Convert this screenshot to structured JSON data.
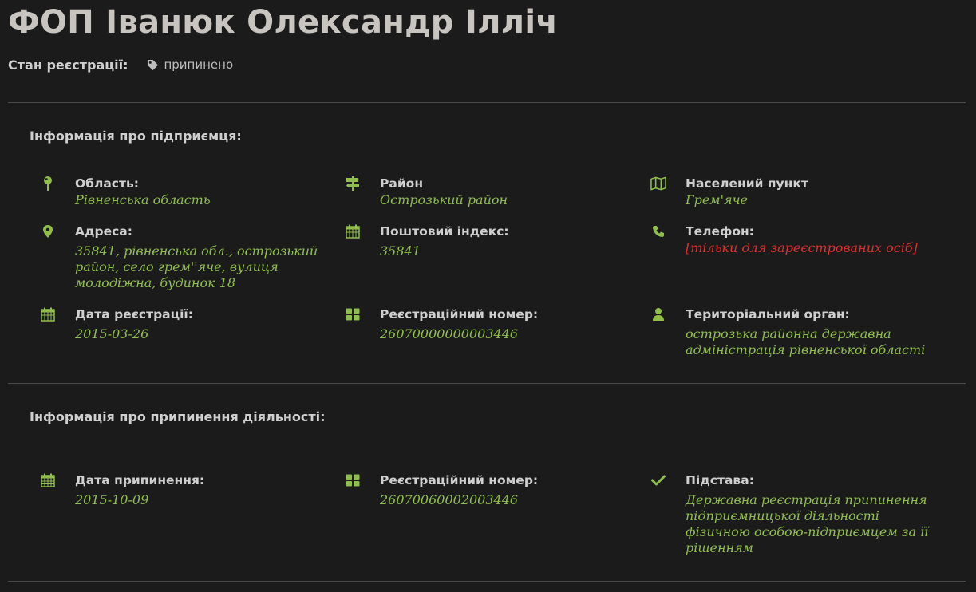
{
  "header": {
    "title": "ФОП Іванюк Олександр Ілліч",
    "status_label": "Стан реєстрації:",
    "status_value": "припинено",
    "status_icon": "tag-icon"
  },
  "colors": {
    "background": "#1b1b1c",
    "accent_green": "#8fbf4a",
    "warning_red": "#e0302b",
    "label_text": "#cfcfcf",
    "title_text": "#c8c4bf"
  },
  "enterprise": {
    "title": "Інформація про підприємця:",
    "fields": {
      "region": {
        "icon": "map-pin-icon",
        "label": "Область:",
        "value": "Рівненська область"
      },
      "district": {
        "icon": "signpost-icon",
        "label": "Район",
        "value": "Острозький район"
      },
      "locality": {
        "icon": "map-icon",
        "label": "Населений пункт",
        "value": "Грем'яче"
      },
      "address": {
        "icon": "location-marker-icon",
        "label": "Адреса:",
        "value": "35841, рівненська обл., острозький район, село грем''яче, вулиця молодіжна, будинок 18"
      },
      "postal_code": {
        "icon": "calendar-icon",
        "label": "Поштовий індекс:",
        "value": "35841"
      },
      "phone": {
        "icon": "phone-icon",
        "label": "Телефон:",
        "value": "[тільки для зареєстрованих осіб]"
      },
      "registration_date": {
        "icon": "calendar-icon",
        "label": "Дата реєстрації:",
        "value": "2015-03-26"
      },
      "registration_number": {
        "icon": "grid-icon",
        "label": "Реєстраційний номер:",
        "value": "26070000000003446"
      },
      "territorial_authority": {
        "icon": "user-icon",
        "label": "Територіальний орган:",
        "value": "острозька районна державна адміністрація рівненської області"
      }
    }
  },
  "termination": {
    "title": "Інформація про припинення діяльності:",
    "fields": {
      "termination_date": {
        "icon": "calendar-icon",
        "label": "Дата припинення:",
        "value": "2015-10-09"
      },
      "registration_number": {
        "icon": "grid-icon",
        "label": "Реєстраційний номер:",
        "value": "26070060002003446"
      },
      "basis": {
        "icon": "checkmark-icon",
        "label": "Підстава:",
        "value": "Державна реєстрація припинення підприємницької діяльності фізичною особою-підприємцем за її рішенням"
      }
    }
  }
}
